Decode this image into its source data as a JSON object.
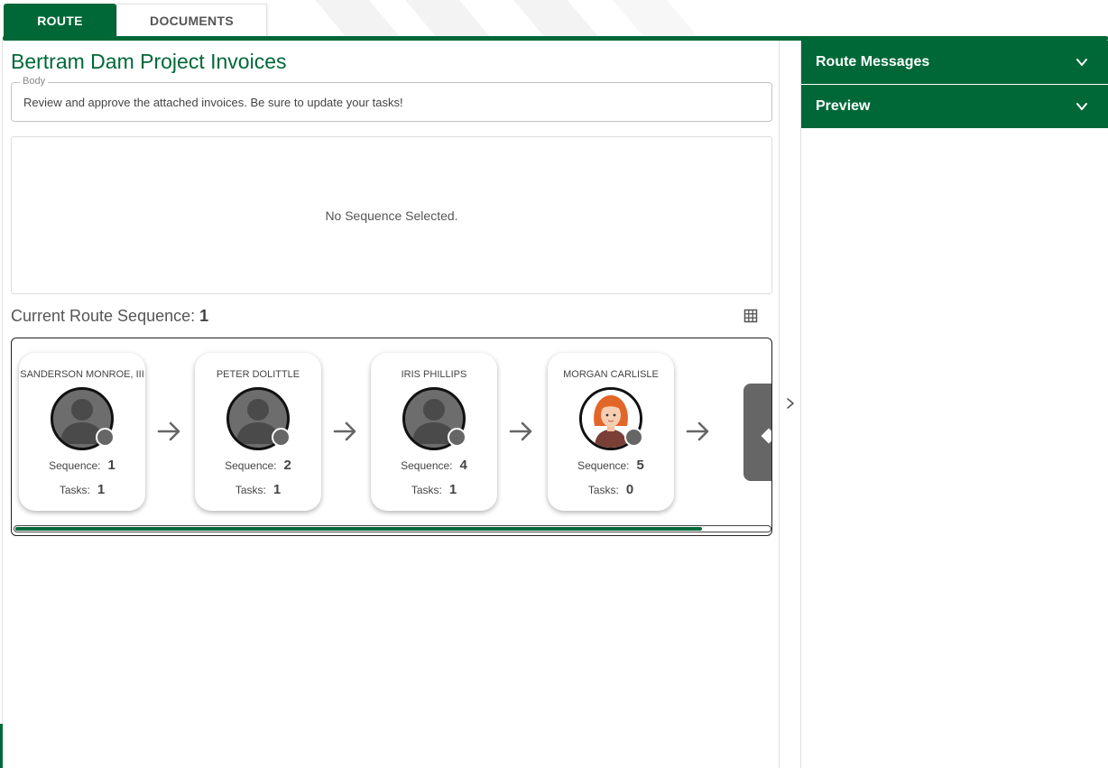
{
  "tabs": [
    {
      "label": "ROUTE",
      "active": true
    },
    {
      "label": "DOCUMENTS",
      "active": false
    }
  ],
  "title": "Bertram Dam Project Invoices",
  "body_field": {
    "label": "Body",
    "value": "Review and approve the attached invoices. Be sure to update your tasks!"
  },
  "sequence_panel": {
    "empty_text": "No Sequence Selected."
  },
  "current_route": {
    "label": "Current Route Sequence:",
    "value": "1"
  },
  "participants": [
    {
      "name": "SANDERSON MONROE, III",
      "sequence_label": "Sequence:",
      "sequence": "1",
      "tasks_label": "Tasks:",
      "tasks": "1",
      "avatar": "default-user-icon"
    },
    {
      "name": "PETER DOLITTLE",
      "sequence_label": "Sequence:",
      "sequence": "2",
      "tasks_label": "Tasks:",
      "tasks": "1",
      "avatar": "default-user-icon"
    },
    {
      "name": "IRIS PHILLIPS",
      "sequence_label": "Sequence:",
      "sequence": "4",
      "tasks_label": "Tasks:",
      "tasks": "1",
      "avatar": "default-user-icon"
    },
    {
      "name": "MORGAN CARLISLE",
      "sequence_label": "Sequence:",
      "sequence": "5",
      "tasks_label": "Tasks:",
      "tasks": "0",
      "avatar": "user-photo-icon"
    }
  ],
  "route_scroll": {
    "position_fraction": 0.91
  },
  "right_panel": {
    "sections": [
      {
        "label": "Route Messages"
      },
      {
        "label": "Preview"
      }
    ]
  },
  "colors": {
    "brand_green": "#006837",
    "status_dot": "#666666",
    "avatar_gray": "#6d6d6d"
  }
}
